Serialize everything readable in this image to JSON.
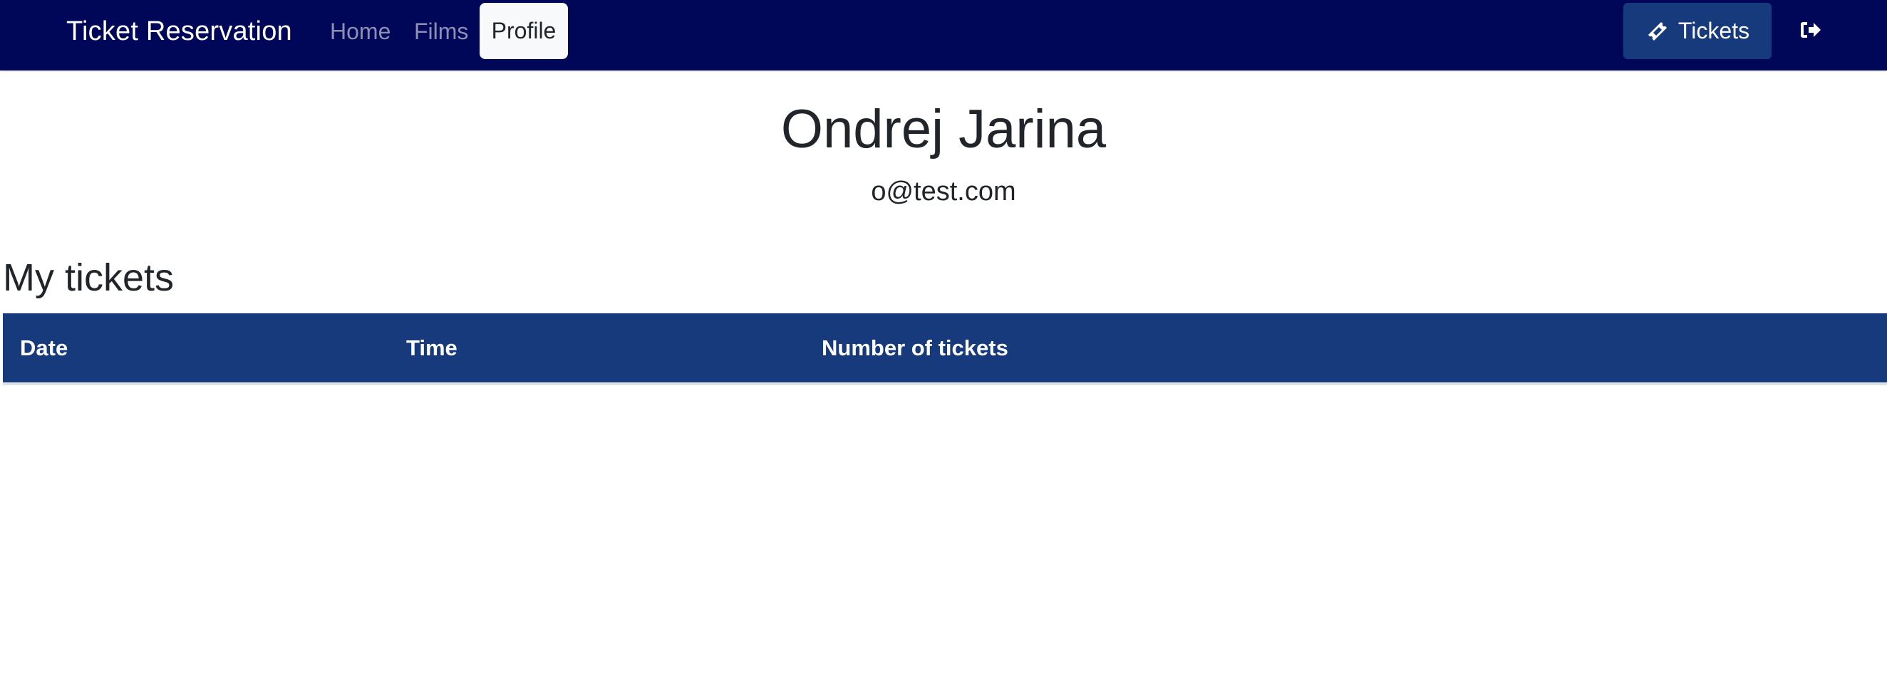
{
  "navbar": {
    "brand": "Ticket Reservation",
    "links": [
      {
        "label": "Home",
        "active": false
      },
      {
        "label": "Films",
        "active": false
      },
      {
        "label": "Profile",
        "active": true
      }
    ],
    "tickets_button": {
      "label": "Tickets",
      "icon": "ticket-icon"
    },
    "logout_button": {
      "icon": "sign-out-icon"
    },
    "background_color": "#000758"
  },
  "profile": {
    "name": "Ondrej Jarina",
    "email": "o@test.com"
  },
  "tickets_section": {
    "title": "My tickets",
    "table": {
      "header_color": "#163a7b",
      "columns": [
        "Date",
        "Time",
        "Number of tickets"
      ],
      "rows": []
    }
  }
}
